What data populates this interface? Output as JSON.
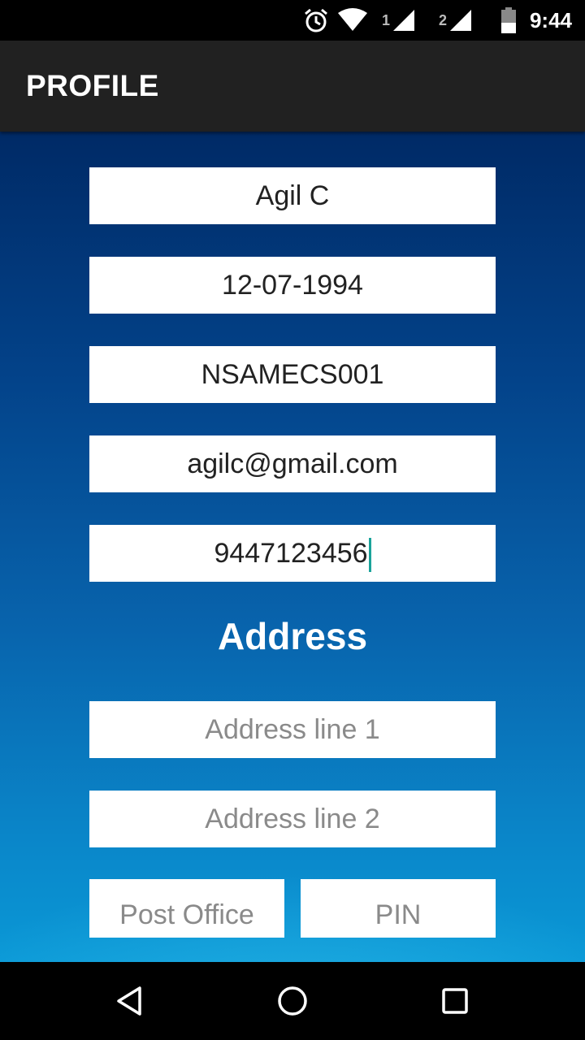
{
  "status_bar": {
    "time": "9:44",
    "sim1_label": "1",
    "sim2_label": "2",
    "icons": [
      "alarm-icon",
      "wifi-icon",
      "signal-icon",
      "signal-icon",
      "battery-icon"
    ]
  },
  "app_bar": {
    "title": "PROFILE"
  },
  "form": {
    "name": {
      "value": "Agil C"
    },
    "dob": {
      "value": "12-07-1994"
    },
    "id": {
      "value": "NSAMECS001"
    },
    "email": {
      "value": "agilc@gmail.com"
    },
    "phone": {
      "value": "9447123456"
    },
    "address_heading": "Address",
    "address_line1": {
      "placeholder": "Address line 1"
    },
    "address_line2": {
      "placeholder": "Address line 2"
    },
    "post_office": {
      "placeholder": "Post Office"
    },
    "pin": {
      "placeholder": "PIN"
    }
  },
  "colors": {
    "app_bar": "#212121",
    "background_top": "#002a66",
    "background_bottom": "#0a98d6",
    "cursor": "#1aa39a"
  },
  "nav_bar": {
    "icons": [
      "back-icon",
      "home-icon",
      "recents-icon"
    ]
  }
}
